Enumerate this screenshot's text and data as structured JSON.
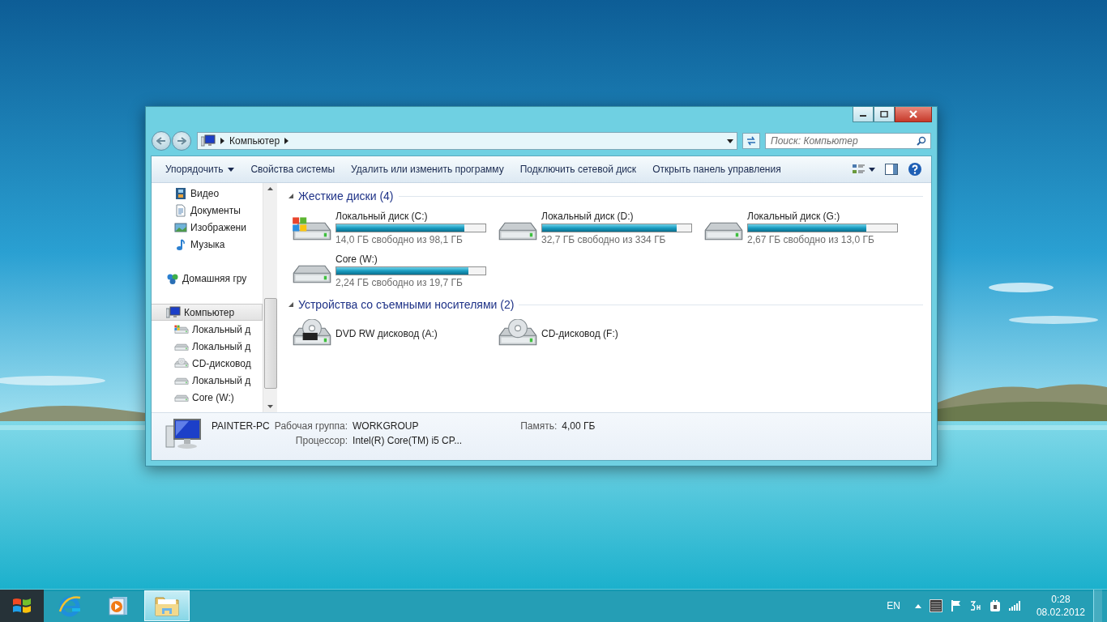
{
  "window": {
    "controls": [
      {
        "kind": "minimize"
      },
      {
        "kind": "maximize"
      },
      {
        "kind": "close"
      }
    ]
  },
  "address": {
    "crumbs": [
      "Компьютер"
    ],
    "search_placeholder": "Поиск: Компьютер"
  },
  "toolbar": [
    {
      "label": "Упорядочить",
      "kind": "menu"
    },
    {
      "label": "Свойства системы",
      "kind": "button"
    },
    {
      "label": "Удалить или изменить программу",
      "kind": "button"
    },
    {
      "label": "Подключить сетевой диск",
      "kind": "button"
    },
    {
      "label": "Открыть панель управления",
      "kind": "button"
    }
  ],
  "sidebar": {
    "items": [
      {
        "label": "Видео",
        "kind": "video",
        "selected": false
      },
      {
        "label": "Документы",
        "kind": "document",
        "selected": false
      },
      {
        "label": "Изображени",
        "kind": "pictures",
        "selected": false
      },
      {
        "label": "Музыка",
        "kind": "music",
        "selected": false
      },
      {
        "label": "Домашняя гру",
        "kind": "homegroup",
        "selected": false
      },
      {
        "label": "Компьютер",
        "kind": "computer",
        "selected": true,
        "children": [
          {
            "label": "Локальный д",
            "kind": "windows-drive",
            "selected": false
          },
          {
            "label": "Локальный д",
            "kind": "drive",
            "selected": false
          },
          {
            "label": "CD-дисковод",
            "kind": "cd",
            "selected": false
          },
          {
            "label": "Локальный д",
            "kind": "drive",
            "selected": false
          },
          {
            "label": "Core (W:)",
            "kind": "drive",
            "selected": false
          }
        ]
      }
    ]
  },
  "groups": [
    {
      "title": "Жесткие диски (4)",
      "expanded": true,
      "items": [
        {
          "name": "Локальный диск (C:)",
          "kind": "windows-drive",
          "level": 0.857,
          "free": "14,0 ГБ свободно из 98,1 ГБ"
        },
        {
          "name": "Локальный диск (D:)",
          "kind": "drive",
          "level": 0.902,
          "free": "32,7 ГБ свободно из 334 ГБ"
        },
        {
          "name": "Локальный диск (G:)",
          "kind": "drive",
          "level": 0.795,
          "free": "2,67 ГБ свободно из 13,0 ГБ"
        },
        {
          "name": "Core (W:)",
          "kind": "drive",
          "level": 0.886,
          "free": "2,24 ГБ свободно из 19,7 ГБ"
        }
      ]
    },
    {
      "title": "Устройства со съемными носителями (2)",
      "expanded": true,
      "items": [
        {
          "name": "DVD RW дисковод (A:)",
          "kind": "dvd"
        },
        {
          "name": "CD-дисковод (F:)",
          "kind": "cd"
        }
      ]
    }
  ],
  "details": {
    "name": "PAINTER-PC",
    "workgroup": {
      "label": "Рабочая группа:",
      "value": "WORKGROUP"
    },
    "memory": {
      "label": "Память:",
      "value": "4,00 ГБ"
    },
    "processor": {
      "label": "Процессор:",
      "value": "Intel(R) Core(TM) i5 CP..."
    }
  },
  "taskbar": {
    "apps": [
      {
        "kind": "browser",
        "selected": false
      },
      {
        "kind": "media",
        "selected": false
      },
      {
        "kind": "explorer",
        "selected": true
      }
    ],
    "language": "EN",
    "time": "0:28",
    "date": "08.02.2012"
  }
}
